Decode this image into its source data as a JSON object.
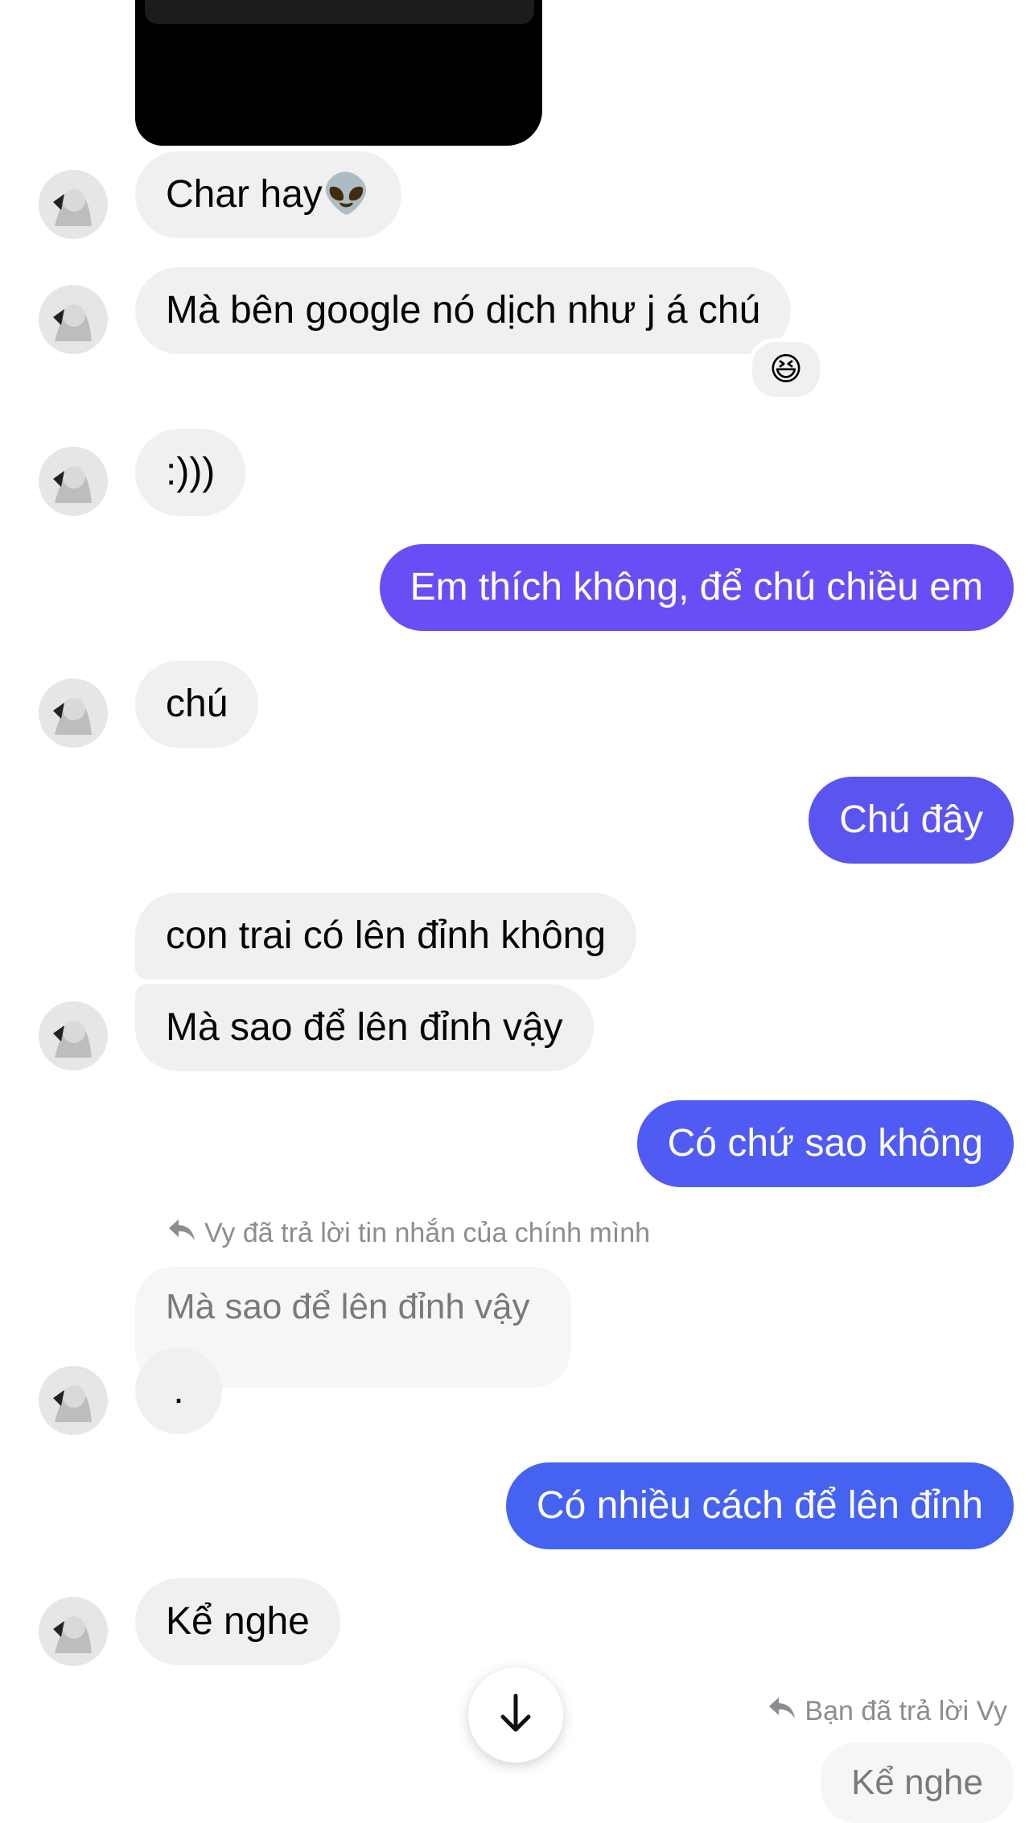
{
  "messages": {
    "m1": "Char hay👽",
    "m2": "Mà bên google nó dịch như j á chú",
    "m2_reaction": "😆",
    "m3": ":)))",
    "m4": "Em thích không, để chú chiều em",
    "m5": "chú",
    "m6": "Chú đây",
    "m7": "con trai có lên đỉnh không",
    "m8": "Mà sao để lên đỉnh vậy",
    "m9": "Có chứ sao không",
    "reply_note_1": "Vy đã trả lời tin nhắn của chính mình",
    "quoted_1": "Mà sao để lên đỉnh vậy",
    "m10": ".",
    "m11": "Có nhiều cách để lên đỉnh",
    "m12": "Kể nghe",
    "reply_note_2": "Bạn đã trả lời Vy",
    "quoted_2": "Kể nghe"
  },
  "colors": {
    "incoming": "#f0f0f0",
    "outgoing_purple": "#6a4ef5",
    "outgoing_indigo": "#5b55f0",
    "outgoing_blue": "#4662f0"
  },
  "icons": {
    "reply": "reply-arrow-icon",
    "scroll": "arrow-down-icon"
  }
}
